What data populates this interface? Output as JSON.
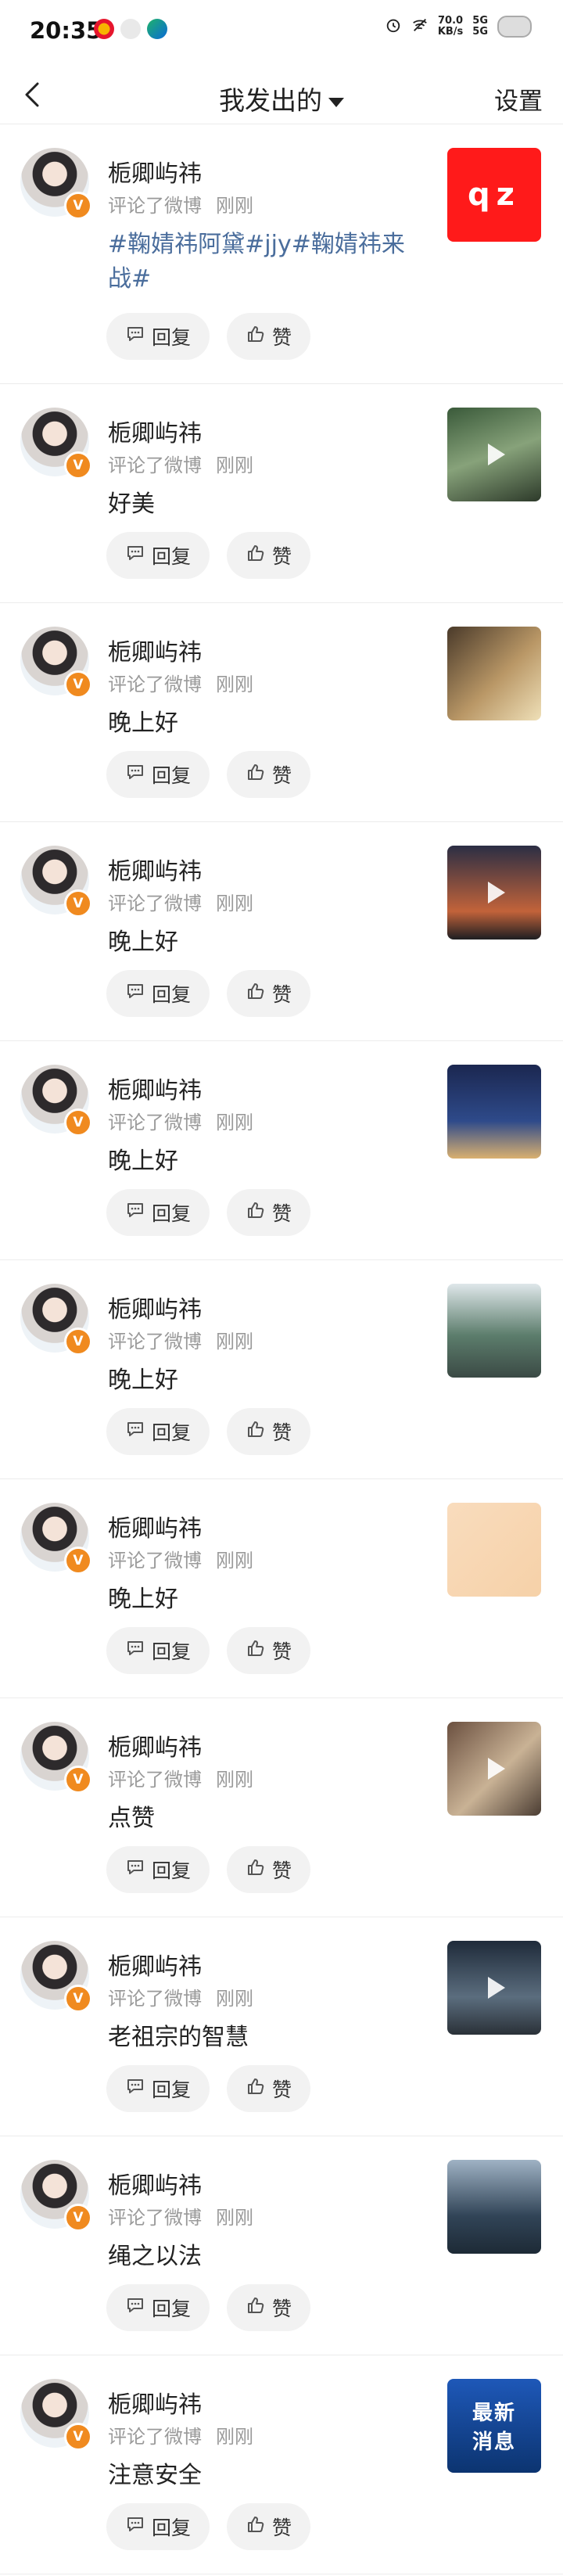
{
  "status_bar": {
    "time": "20:35",
    "net_speed": "70.0\nKB/s",
    "signal": "5G\n5G",
    "app_icons": [
      "weibo-icon",
      "dot-icon",
      "app-icon"
    ]
  },
  "nav": {
    "title": "我发出的",
    "settings": "设置"
  },
  "labels": {
    "reply": "回复",
    "like": "赞"
  },
  "items": [
    {
      "name": "栀卿屿祎",
      "action": "评论了微博",
      "time": "刚刚",
      "content": "#鞠婧祎阿黛#jjy#鞠婧祎来战#",
      "thumb": {
        "kind": "text",
        "text": "qz",
        "bg": "#ff1a1a"
      }
    },
    {
      "name": "栀卿屿祎",
      "action": "评论了微博",
      "time": "刚刚",
      "content": "好美",
      "thumb": {
        "kind": "video",
        "bg": "linear-gradient(160deg,#3a5a3a,#87a27a 50%,#2d3a2a)"
      }
    },
    {
      "name": "栀卿屿祎",
      "action": "评论了微博",
      "time": "刚刚",
      "content": "晚上好",
      "thumb": {
        "kind": "image",
        "bg": "linear-gradient(135deg,#4a3a2a,#b99766 55%,#efe0b8)"
      }
    },
    {
      "name": "栀卿屿祎",
      "action": "评论了微博",
      "time": "刚刚",
      "content": "晚上好",
      "thumb": {
        "kind": "video",
        "bg": "linear-gradient(180deg,#2b2e44,#c2633a 70%,#1e1e22)"
      }
    },
    {
      "name": "栀卿屿祎",
      "action": "评论了微博",
      "time": "刚刚",
      "content": "晚上好",
      "thumb": {
        "kind": "image",
        "bg": "linear-gradient(180deg,#1b2750,#2e4a8a 60%,#d9b070)"
      }
    },
    {
      "name": "栀卿屿祎",
      "action": "评论了微博",
      "time": "刚刚",
      "content": "晚上好",
      "thumb": {
        "kind": "image",
        "bg": "linear-gradient(180deg,#dfe7ea,#5c7d6c 55%,#3b4a45)"
      }
    },
    {
      "name": "栀卿屿祎",
      "action": "评论了微博",
      "time": "刚刚",
      "content": "晚上好",
      "thumb": {
        "kind": "image",
        "bg": "linear-gradient(135deg,#f9dcbd,#f6d1a8)"
      }
    },
    {
      "name": "栀卿屿祎",
      "action": "评论了微博",
      "time": "刚刚",
      "content": "点赞",
      "thumb": {
        "kind": "video",
        "bg": "linear-gradient(135deg,#6b5040,#c9b295 55%,#4b3d33)"
      }
    },
    {
      "name": "栀卿屿祎",
      "action": "评论了微博",
      "time": "刚刚",
      "content": "老祖宗的智慧",
      "thumb": {
        "kind": "video",
        "bg": "linear-gradient(180deg,#1f2b3a,#5b6d7e 60%,#2a3138)"
      }
    },
    {
      "name": "栀卿屿祎",
      "action": "评论了微博",
      "time": "刚刚",
      "content": "绳之以法",
      "thumb": {
        "kind": "image",
        "bg": "linear-gradient(180deg,#9fb2c4,#314457 60%,#1d2a36)"
      }
    },
    {
      "name": "栀卿屿祎",
      "action": "评论了微博",
      "time": "刚刚",
      "content": "注意安全",
      "thumb": {
        "kind": "text",
        "text": "最新\n消息",
        "bg": "linear-gradient(180deg,#1e58b8,#0c3470)"
      }
    }
  ]
}
